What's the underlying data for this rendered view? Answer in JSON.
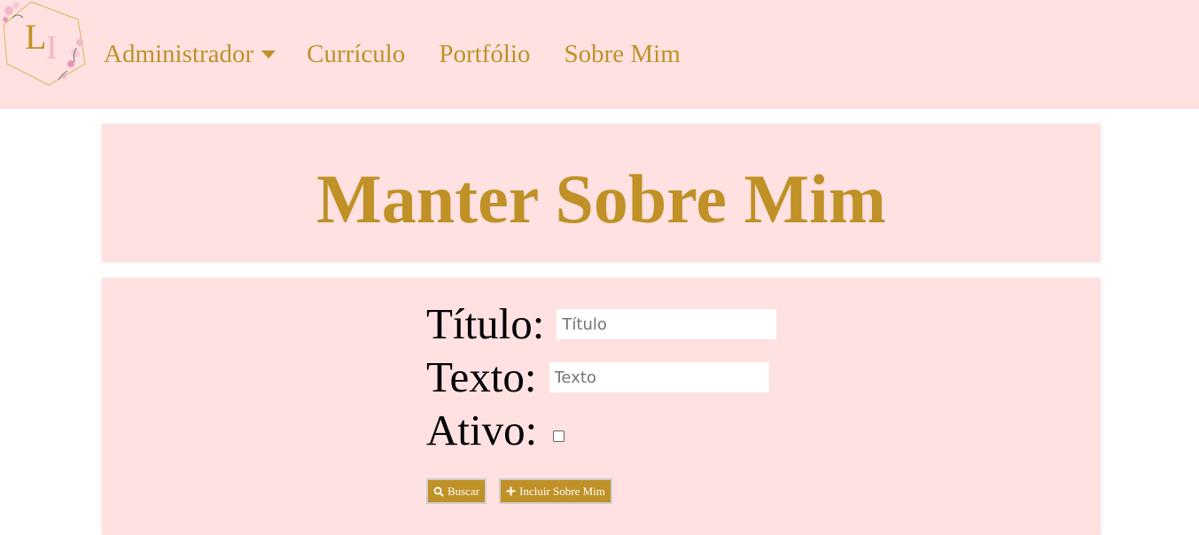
{
  "logo": {
    "letters": "LI",
    "icon": "floral-monogram-logo"
  },
  "nav": {
    "admin": "Administrador",
    "curriculo": "Currículo",
    "portfolio": "Portfólio",
    "sobre": "Sobre Mim"
  },
  "page": {
    "title": "Manter Sobre Mim"
  },
  "form": {
    "titulo_label": "Título:",
    "titulo_placeholder": "Título",
    "texto_label": "Texto:",
    "texto_placeholder": "Texto",
    "ativo_label": "Ativo:",
    "ativo_checked": false
  },
  "buttons": {
    "buscar": "Buscar",
    "incluir": "Incluir Sobre Mim"
  },
  "colors": {
    "accent": "#bf9127",
    "background": "#ffe1e1"
  }
}
